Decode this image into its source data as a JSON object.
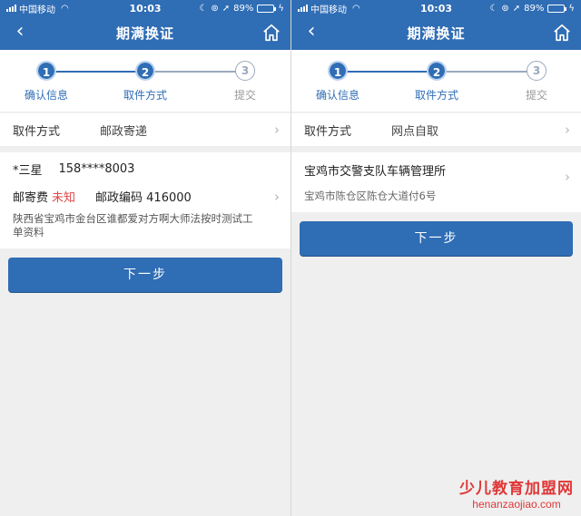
{
  "status": {
    "carrier": "中国移动",
    "time": "10:03",
    "battery": "89%",
    "battery_level": 0.89
  },
  "colors": {
    "brand": "#2f6db5",
    "warning": "#e04545",
    "watermark": "#e03737"
  },
  "screens": [
    {
      "nav": {
        "title": "期满换证",
        "back_icon": "chevron-left-icon",
        "home_icon": "home-icon"
      },
      "steps": [
        {
          "num": "1",
          "label": "确认信息"
        },
        {
          "num": "2",
          "label": "取件方式"
        },
        {
          "num": "3",
          "label": "提交"
        }
      ],
      "current_step": 2,
      "method": {
        "label": "取件方式",
        "value": "邮政寄递"
      },
      "address": {
        "name": "*三星",
        "phone": "158****8003",
        "postage_label": "邮寄费",
        "postage_value": "未知",
        "postcode": "邮政编码 416000",
        "text": "陕西省宝鸡市金台区谁都爱对方啊大师法按时测试工单资料"
      },
      "next_button": "下一步"
    },
    {
      "nav": {
        "title": "期满换证",
        "back_icon": "chevron-left-icon",
        "home_icon": "home-icon"
      },
      "steps": [
        {
          "num": "1",
          "label": "确认信息"
        },
        {
          "num": "2",
          "label": "取件方式"
        },
        {
          "num": "3",
          "label": "提交"
        }
      ],
      "current_step": 2,
      "method": {
        "label": "取件方式",
        "value": "网点自取"
      },
      "station": {
        "name": "宝鸡市交警支队车辆管理所",
        "address": "宝鸡市陈仓区陈仓大道付6号"
      },
      "next_button": "下一步"
    }
  ],
  "watermark": {
    "line1": "少儿教育加盟网",
    "line2": "henanzaojiao.com"
  }
}
